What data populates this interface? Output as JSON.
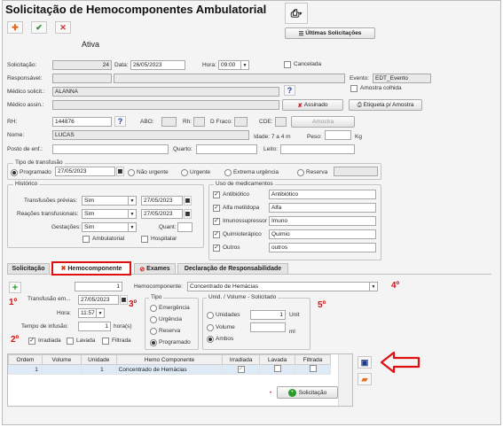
{
  "title": "Solicitação de Hemocomponentes Ambulatorial",
  "status": "Ativa",
  "ultimas_label": "Últimas Solicitações",
  "f": {
    "solicitacao_l": "Solicitação:",
    "solicitacao_v": "24",
    "data_l": "Data:",
    "data_v": "26/05/2023",
    "hora_l": "Hora:",
    "hora_v": "09:00",
    "cancelada": "Cancelada",
    "responsavel_l": "Responsável:",
    "evento_l": "Evento:",
    "evento_v": "EDT_Evento",
    "amostra_colhida": "Amostra colhida",
    "medico_sol_l": "Médico solicit.:",
    "medico_sol_v": "ALANNA",
    "medico_ass_l": "Médico assin.:",
    "assinado": "Assinado",
    "etiqueta": "Etiqueta p/ Amostra",
    "rh_l": "RH:",
    "rh_v": "144876",
    "abo_l": "ABO:",
    "rh2_l": "Rh:",
    "dfraco_l": "D Fraco:",
    "cde_l": "CDE:",
    "amostra_btn": "Amostra",
    "nome_l": "Nome:",
    "nome_v": "LUCAS",
    "idade_l": "Idade: 7 a 4 m",
    "peso_l": "Peso:",
    "peso_unit": "Kg",
    "posto_l": "Posto de enf.:",
    "quarto_l": "Quarto:",
    "leito_l": "Leito:"
  },
  "tipo": {
    "label": "Tipo de transfusão",
    "opts": [
      "Programado",
      "Não urgente",
      "Urgente",
      "Extrema urgência",
      "Reserva"
    ],
    "date": "27/05/2023"
  },
  "hist": {
    "label": "Histórico",
    "tp_l": "Transfusões prévias:",
    "tp_v": "Sim",
    "tp_d": "27/05/2023",
    "rt_l": "Reações transfusionais:",
    "rt_v": "Sim",
    "rt_d": "27/05/2023",
    "gest_l": "Gestações:",
    "gest_v": "Sim",
    "quant_l": "Quant:",
    "ambulatorial": "Ambulatorial",
    "hospitalar": "Hospitalar"
  },
  "meds": {
    "label": "Uso de medicamentos",
    "items": [
      {
        "name": "Antibiótico",
        "value": "Antibiótico"
      },
      {
        "name": "Alfa metildopa",
        "value": "Alfa"
      },
      {
        "name": "Imunossupressor",
        "value": "Imuno"
      },
      {
        "name": "Quimioterápico",
        "value": "Quimio"
      },
      {
        "name": "Outros",
        "value": "outros"
      }
    ]
  },
  "tabs": [
    "Solicitação",
    "Hemocomponente",
    "Exames",
    "Declaração de Responsabilidade"
  ],
  "hemo": {
    "qty": "1",
    "transf_l": "Transfusão em...",
    "transf_v": "27/05/2023",
    "hora_l": "Hora:",
    "hora_v": "11:57",
    "tempo_l": "Tempo de infusão:",
    "tempo_v": "1",
    "tempo_u": "hora(s)",
    "irradiada": "Irradiada",
    "lavada": "Lavada",
    "filtrada": "Filtrada",
    "hc_l": "Hemocomponente:",
    "hc_v": "Concentrado de Hemácias",
    "tipo_l": "Tipo",
    "tipo_opts": [
      "Emergência",
      "Urgência",
      "Reserva",
      "Programado"
    ],
    "unid_l": "Unid. / Volume - Solicitado",
    "u_opts": [
      "Unidades",
      "Volume",
      "Ambos"
    ],
    "u_v": "1",
    "u_unit": "Unit",
    "ml": "ml"
  },
  "ann": [
    "1º",
    "2º",
    "3º",
    "4º",
    "5º"
  ],
  "table": {
    "headers": [
      "Ordem",
      "Volume",
      "Unidade",
      "Hemo Componente",
      "Irradiada",
      "Lavada",
      "Filtrada"
    ],
    "rows": [
      {
        "ordem": "1",
        "volume": "",
        "unidade": "1",
        "hc": "Concentrado de Hemácias"
      }
    ]
  },
  "footer": {
    "solicitacao_btn": "Solicitação"
  },
  "colors": {
    "annotation": "#d21515",
    "accent": "#2a7a2a"
  }
}
